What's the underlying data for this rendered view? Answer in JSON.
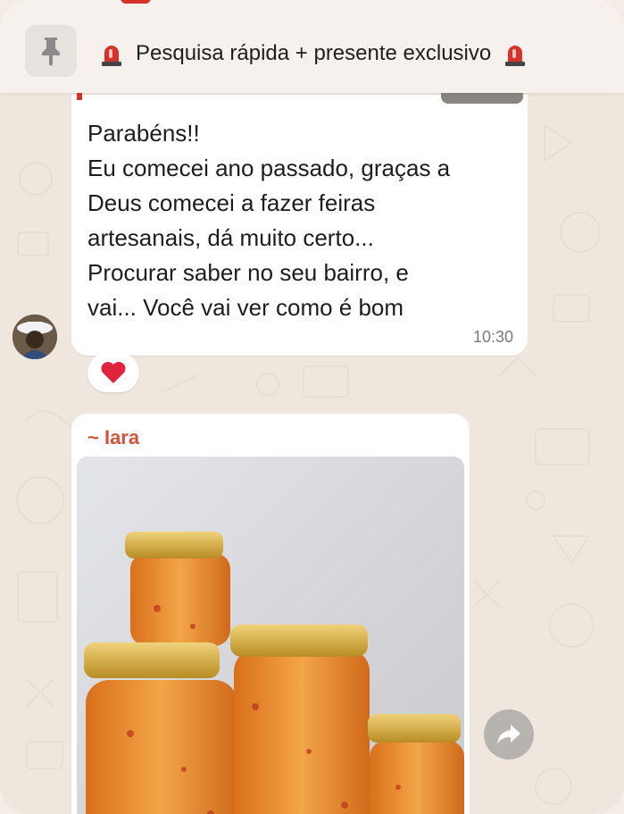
{
  "pinned": {
    "title": "Pesquisa rápida + presente exclusivo",
    "icon": "pin-icon",
    "emoji_icon": "police-light-icon"
  },
  "message1": {
    "text": "Parabéns!!\nEu comecei ano passado, graças a\nDeus comecei a fazer feiras\nartesanais, dá muito certo...\nProcurar saber no seu bairro, e\nvai... Você vai ver como é bom",
    "time": "10:30",
    "reaction": "❤️"
  },
  "message2": {
    "sender": "~ Iara",
    "media": "photo-of-jam-jars"
  },
  "colors": {
    "background": "#efe7dd",
    "bubble": "#ffffff",
    "sender_name": "#d1553a",
    "siren_red": "#d4322b",
    "jar_lid": "#d8b13a",
    "jam": "#e98b2b"
  }
}
